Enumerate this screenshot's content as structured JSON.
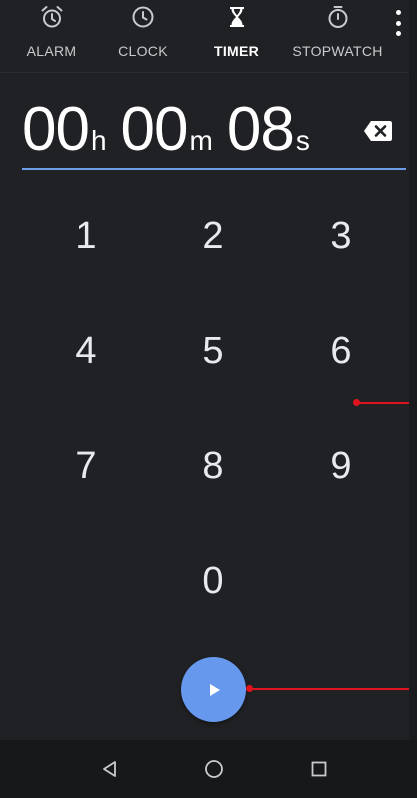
{
  "tabs": [
    {
      "label": "ALARM",
      "icon": "alarm-clock-icon"
    },
    {
      "label": "CLOCK",
      "icon": "clock-icon"
    },
    {
      "label": "TIMER",
      "icon": "hourglass-icon",
      "active": true
    },
    {
      "label": "STOPWATCH",
      "icon": "stopwatch-icon"
    }
  ],
  "timer": {
    "hours": "00",
    "hours_unit": "h",
    "minutes": "00",
    "minutes_unit": "m",
    "seconds": "08",
    "seconds_unit": "s"
  },
  "keypad": [
    "1",
    "2",
    "3",
    "4",
    "5",
    "6",
    "7",
    "8",
    "9",
    "0"
  ],
  "colors": {
    "background": "#202124",
    "accent": "#6699ee",
    "underline": "#6c9ee8",
    "annotation": "#e0141c",
    "navbar": "#17181a"
  },
  "icons": {
    "backspace": "backspace-icon",
    "start": "play-icon",
    "overflow": "more-vert-icon",
    "nav_back": "back-triangle-icon",
    "nav_home": "home-circle-icon",
    "nav_recents": "recents-square-icon"
  }
}
